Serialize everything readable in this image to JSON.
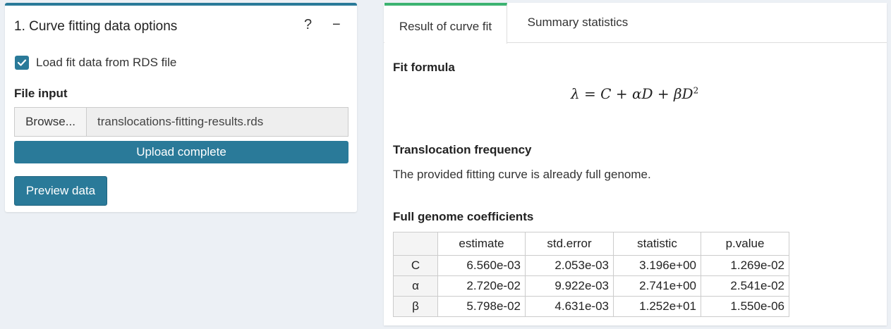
{
  "left_panel": {
    "title": "1. Curve fitting data options",
    "help_label": "?",
    "collapse_label": "−",
    "checkbox_label": "Load fit data from RDS file",
    "checkbox_checked": true,
    "file_input_label": "File input",
    "browse_label": "Browse...",
    "file_name": "translocations-fitting-results.rds",
    "upload_status": "Upload complete",
    "upload_progress": 1.0,
    "preview_label": "Preview data"
  },
  "right_panel": {
    "tabs": [
      {
        "label": "Result of curve fit",
        "active": true
      },
      {
        "label": "Summary statistics",
        "active": false
      }
    ],
    "fit_formula_heading": "Fit formula",
    "formula": {
      "lhs": "λ",
      "eq": "=",
      "rhs": "C + αD + βD",
      "exponent": "2"
    },
    "translocation_heading": "Translocation frequency",
    "translocation_text": "The provided fitting curve is already full genome.",
    "coefficients_heading": "Full genome coefficients",
    "table": {
      "columns": [
        "",
        "estimate",
        "std.error",
        "statistic",
        "p.value"
      ],
      "rows": [
        [
          "C",
          "6.560e-03",
          "2.053e-03",
          "3.196e+00",
          "1.269e-02"
        ],
        [
          "α",
          "2.720e-02",
          "9.922e-03",
          "2.741e+00",
          "2.541e-02"
        ],
        [
          "β",
          "5.798e-02",
          "4.631e-03",
          "1.252e+01",
          "1.550e-06"
        ]
      ]
    }
  },
  "colors": {
    "primary": "#2a7a99",
    "active_tab_accent": "#3cb371",
    "background": "#ecf0f5"
  }
}
